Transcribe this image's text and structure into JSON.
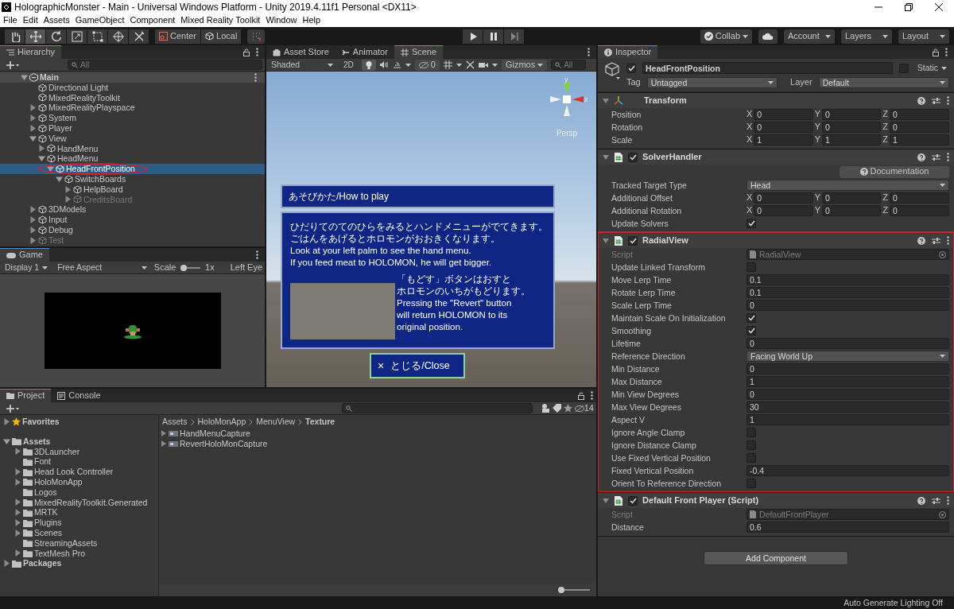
{
  "window": {
    "title": "HolographicMonster - Main - Universal Windows Platform - Unity 2019.4.11f1 Personal <DX11>"
  },
  "menu": [
    "File",
    "Edit",
    "Assets",
    "GameObject",
    "Component",
    "Mixed Reality Toolkit",
    "Window",
    "Help"
  ],
  "toolbar": {
    "tools": [
      {
        "kind": "hand",
        "selected": false
      },
      {
        "kind": "move",
        "selected": true
      },
      {
        "kind": "rotate",
        "selected": false
      },
      {
        "kind": "scale",
        "selected": false
      },
      {
        "kind": "rect",
        "selected": false
      },
      {
        "kind": "transform",
        "selected": false
      },
      {
        "kind": "custom",
        "selected": false
      }
    ],
    "pivot": [
      "Center",
      "Local"
    ],
    "right": [
      {
        "kind": "collab",
        "label": "Collab"
      },
      {
        "kind": "cloud"
      },
      {
        "kind": "menu",
        "label": "Account"
      },
      {
        "kind": "menu",
        "label": "Layers"
      },
      {
        "kind": "menu",
        "label": "Layout"
      }
    ]
  },
  "hierarchy": {
    "title": "Hierarchy",
    "search_placeholder": "All",
    "tree": [
      {
        "label": "Main",
        "kind": "scene",
        "expandable": true,
        "expanded": true,
        "selected": false,
        "inactive": false,
        "children": [
          {
            "label": "Directional Light",
            "kind": "object",
            "expandable": false,
            "selected": false,
            "inactive": false
          },
          {
            "label": "MixedRealityToolkit",
            "kind": "object",
            "expandable": false,
            "selected": false,
            "inactive": false
          },
          {
            "label": "MixedRealityPlayspace",
            "kind": "object",
            "expandable": true,
            "expanded": false,
            "selected": false,
            "inactive": false
          },
          {
            "label": "System",
            "kind": "object",
            "expandable": true,
            "expanded": false,
            "selected": false,
            "inactive": false
          },
          {
            "label": "Player",
            "kind": "object",
            "expandable": true,
            "expanded": false,
            "selected": false,
            "inactive": false
          },
          {
            "label": "View",
            "kind": "object",
            "expandable": true,
            "expanded": true,
            "selected": false,
            "inactive": false,
            "children": [
              {
                "label": "HandMenu",
                "kind": "object",
                "expandable": true,
                "expanded": false,
                "selected": false,
                "inactive": false
              },
              {
                "label": "HeadMenu",
                "kind": "object",
                "expandable": true,
                "expanded": true,
                "selected": false,
                "inactive": false,
                "children": [
                  {
                    "label": "HeadFrontPosition",
                    "kind": "object",
                    "expandable": true,
                    "expanded": true,
                    "selected": true,
                    "inactive": false,
                    "annotated": true,
                    "children": [
                      {
                        "label": "SwitchBoards",
                        "kind": "object",
                        "expandable": true,
                        "expanded": true,
                        "selected": false,
                        "inactive": false,
                        "children": [
                          {
                            "label": "HelpBoard",
                            "kind": "object",
                            "expandable": true,
                            "expanded": false,
                            "selected": false,
                            "inactive": false
                          },
                          {
                            "label": "CreditsBoard",
                            "kind": "object",
                            "expandable": true,
                            "expanded": false,
                            "selected": false,
                            "inactive": true
                          }
                        ]
                      }
                    ]
                  }
                ]
              }
            ]
          },
          {
            "label": "3DModels",
            "kind": "object",
            "expandable": true,
            "expanded": false,
            "selected": false,
            "inactive": false
          },
          {
            "label": "Input",
            "kind": "object",
            "expandable": true,
            "expanded": false,
            "selected": false,
            "inactive": false
          },
          {
            "label": "Debug",
            "kind": "object",
            "expandable": true,
            "expanded": false,
            "selected": false,
            "inactive": false
          },
          {
            "label": "Test",
            "kind": "object",
            "expandable": true,
            "expanded": false,
            "selected": false,
            "inactive": true
          }
        ]
      }
    ]
  },
  "game": {
    "title": "Game",
    "display": "Display 1",
    "aspect": "Free Aspect",
    "scale_label": "Scale",
    "scale": {
      "level": 0.0
    },
    "scale_value": "1x",
    "eye": "Left Eye"
  },
  "scene": {
    "tabs": [
      {
        "kind": "store",
        "label": "Asset Store",
        "selected": false
      },
      {
        "kind": "animator",
        "label": "Animator",
        "selected": false
      },
      {
        "kind": "scene",
        "label": "Scene",
        "selected": true
      }
    ],
    "shading": "Shaded",
    "mode_2d": "2D",
    "hidden_count": "0",
    "gizmos": "Gizmos",
    "search_placeholder": "All",
    "axis_y": "y",
    "axis_x": "x",
    "projection": "Persp",
    "board": {
      "title": "あそびかた/How to play",
      "lines": [
        "ひだりてのてのひらをみるとハンドメニューがでてきます。",
        "ごはんをあげるとホロモンがおおきくなります。",
        "Look at your left palm to see the hand menu.",
        "If you feed meat to HOLOMON, he will get bigger."
      ],
      "side_lines": [
        "「もどす」ボタンはおすと",
        "ホロモンのいちがもどります。",
        "Pressing the \"Revert\" button",
        "will return HOLOMON to its",
        "original position."
      ],
      "close_glyph": "×",
      "close_label": "とじる/Close"
    }
  },
  "inspector": {
    "title": "Inspector",
    "object_name": "HeadFrontPosition",
    "active": true,
    "static_label": "Static",
    "static": false,
    "tag_label": "Tag",
    "tag": "Untagged",
    "layer_label": "Layer",
    "layer": "Default",
    "components": [
      {
        "name": "Transform",
        "kind": "transform",
        "fields": [
          {
            "kind": "vector",
            "label": "Position",
            "parts": [
              {
                "axis": "X",
                "value": "0"
              },
              {
                "axis": "Y",
                "value": "0"
              },
              {
                "axis": "Z",
                "value": "0"
              }
            ]
          },
          {
            "kind": "vector",
            "label": "Rotation",
            "parts": [
              {
                "axis": "X",
                "value": "0"
              },
              {
                "axis": "Y",
                "value": "0"
              },
              {
                "axis": "Z",
                "value": "0"
              }
            ]
          },
          {
            "kind": "vector",
            "label": "Scale",
            "parts": [
              {
                "axis": "X",
                "value": "1"
              },
              {
                "axis": "Y",
                "value": "1"
              },
              {
                "axis": "Z",
                "value": "1"
              }
            ]
          }
        ]
      },
      {
        "name": "SolverHandler",
        "kind": "script",
        "enabled": true,
        "fields": [
          {
            "kind": "button",
            "label": "Documentation"
          },
          {
            "kind": "dropdown",
            "label": "Tracked Target Type",
            "value": "Head"
          },
          {
            "kind": "vector",
            "label": "Additional Offset",
            "parts": [
              {
                "axis": "X",
                "value": "0"
              },
              {
                "axis": "Y",
                "value": "0"
              },
              {
                "axis": "Z",
                "value": "0"
              }
            ]
          },
          {
            "kind": "vector",
            "label": "Additional Rotation",
            "parts": [
              {
                "axis": "X",
                "value": "0"
              },
              {
                "axis": "Y",
                "value": "0"
              },
              {
                "axis": "Z",
                "value": "0"
              }
            ]
          },
          {
            "kind": "checkbox",
            "label": "Update Solvers",
            "checked": true
          }
        ]
      },
      {
        "name": "RadialView",
        "kind": "script",
        "enabled": true,
        "annotated": true,
        "fields": [
          {
            "kind": "object",
            "label": "Script",
            "value": "RadialView"
          },
          {
            "kind": "checkbox",
            "label": "Update Linked Transform",
            "checked": false
          },
          {
            "kind": "number",
            "label": "Move Lerp Time",
            "value": "0.1"
          },
          {
            "kind": "number",
            "label": "Rotate Lerp Time",
            "value": "0.1"
          },
          {
            "kind": "number",
            "label": "Scale Lerp Time",
            "value": "0"
          },
          {
            "kind": "checkbox",
            "label": "Maintain Scale On Initialization",
            "checked": true
          },
          {
            "kind": "checkbox",
            "label": "Smoothing",
            "checked": true
          },
          {
            "kind": "number",
            "label": "Lifetime",
            "value": "0"
          },
          {
            "kind": "dropdown",
            "label": "Reference Direction",
            "value": "Facing World Up"
          },
          {
            "kind": "number",
            "label": "Min Distance",
            "value": "0"
          },
          {
            "kind": "number",
            "label": "Max Distance",
            "value": "1"
          },
          {
            "kind": "number",
            "label": "Min View Degrees",
            "value": "0"
          },
          {
            "kind": "number",
            "label": "Max View Degrees",
            "value": "30"
          },
          {
            "kind": "number",
            "label": "Aspect V",
            "value": "1"
          },
          {
            "kind": "checkbox",
            "label": "Ignore Angle Clamp",
            "checked": false
          },
          {
            "kind": "checkbox",
            "label": "Ignore Distance Clamp",
            "checked": false
          },
          {
            "kind": "checkbox",
            "label": "Use Fixed Vertical Position",
            "checked": false
          },
          {
            "kind": "number",
            "label": "Fixed Vertical Position",
            "value": "-0.4"
          },
          {
            "kind": "checkbox",
            "label": "Orient To Reference Direction",
            "checked": false
          }
        ]
      },
      {
        "name": "Default Front Player (Script)",
        "kind": "script",
        "enabled": true,
        "fields": [
          {
            "kind": "object",
            "label": "Script",
            "value": "DefaultFrontPlayer"
          },
          {
            "kind": "number",
            "label": "Distance",
            "value": "0.6"
          }
        ]
      }
    ],
    "add_button": "Add Component"
  },
  "project": {
    "tabs": [
      {
        "kind": "project",
        "label": "Project",
        "selected": true
      },
      {
        "kind": "console",
        "label": "Console",
        "selected": false
      }
    ],
    "hidden_count": "14",
    "tree": [
      {
        "label": "Favorites",
        "kind": "favorites",
        "expandable": true,
        "expanded": false
      },
      {
        "label": "Assets",
        "kind": "folder",
        "expandable": true,
        "expanded": true,
        "children": [
          {
            "label": "3DLauncher",
            "kind": "folder",
            "expandable": true,
            "expanded": false
          },
          {
            "label": "Font",
            "kind": "folder",
            "expandable": false
          },
          {
            "label": "Head Look Controller",
            "kind": "folder",
            "expandable": true,
            "expanded": false
          },
          {
            "label": "HoloMonApp",
            "kind": "folder",
            "expandable": true,
            "expanded": false
          },
          {
            "label": "Logos",
            "kind": "folder",
            "expandable": false
          },
          {
            "label": "MixedRealityToolkit.Generated",
            "kind": "folder",
            "expandable": true,
            "expanded": false
          },
          {
            "label": "MRTK",
            "kind": "folder",
            "expandable": true,
            "expanded": false
          },
          {
            "label": "Plugins",
            "kind": "folder",
            "expandable": true,
            "expanded": false
          },
          {
            "label": "Scenes",
            "kind": "folder",
            "expandable": true,
            "expanded": false
          },
          {
            "label": "StreamingAssets",
            "kind": "folder",
            "expandable": false
          },
          {
            "label": "TextMesh Pro",
            "kind": "folder",
            "expandable": true,
            "expanded": false
          }
        ]
      },
      {
        "label": "Packages",
        "kind": "folder",
        "expandable": true,
        "expanded": false
      }
    ],
    "breadcrumb": [
      "Assets",
      "HoloMonApp",
      "MenuView",
      "Texture"
    ],
    "files": [
      "HandMenuCapture",
      "RevertHoloMonCapture"
    ],
    "zoom": {
      "level": 0.0
    }
  },
  "status_bar": "Auto Generate Lighting Off"
}
